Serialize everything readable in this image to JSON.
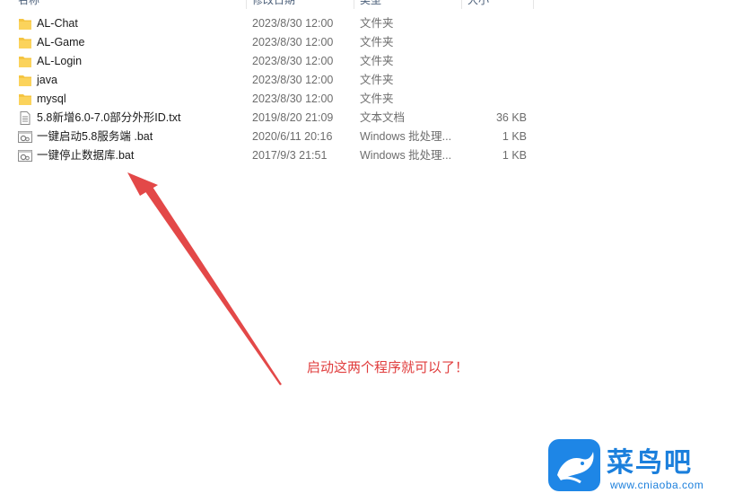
{
  "columns": {
    "name": "名称",
    "date": "修改日期",
    "type": "类型",
    "size": "大小"
  },
  "files": [
    {
      "name": "AL-Chat",
      "date": "2023/8/30 12:00",
      "type": "文件夹",
      "size": "",
      "icon": "folder-icon"
    },
    {
      "name": "AL-Game",
      "date": "2023/8/30 12:00",
      "type": "文件夹",
      "size": "",
      "icon": "folder-icon"
    },
    {
      "name": "AL-Login",
      "date": "2023/8/30 12:00",
      "type": "文件夹",
      "size": "",
      "icon": "folder-icon"
    },
    {
      "name": "java",
      "date": "2023/8/30 12:00",
      "type": "文件夹",
      "size": "",
      "icon": "folder-icon"
    },
    {
      "name": "mysql",
      "date": "2023/8/30 12:00",
      "type": "文件夹",
      "size": "",
      "icon": "folder-icon"
    },
    {
      "name": "5.8新增6.0-7.0部分外形ID.txt",
      "date": "2019/8/20 21:09",
      "type": "文本文档",
      "size": "36 KB",
      "icon": "text-file-icon"
    },
    {
      "name": "一键启动5.8服务端 .bat",
      "date": "2020/6/11 20:16",
      "type": "Windows 批处理...",
      "size": "1 KB",
      "icon": "batch-file-icon"
    },
    {
      "name": "一键停止数据库.bat",
      "date": "2017/9/3 21:51",
      "type": "Windows 批处理...",
      "size": "1 KB",
      "icon": "batch-file-icon"
    }
  ],
  "annotation": {
    "text": "启动这两个程序就可以了！",
    "color": "#e03c3c"
  },
  "watermark": {
    "title": "菜鸟吧",
    "url": "www.cniaoba.com",
    "brand_color": "#1b7fdc"
  },
  "colors": {
    "folder": "#f5c542",
    "secondary_text": "#6d6d6d"
  }
}
